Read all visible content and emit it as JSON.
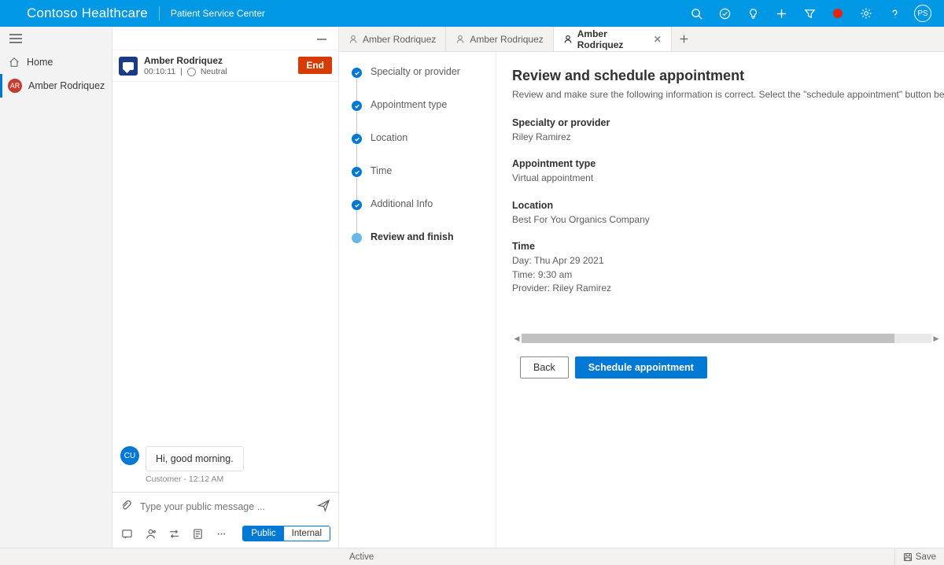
{
  "topbar": {
    "brand": "Contoso Healthcare",
    "subtitle": "Patient Service Center",
    "avatar_initials": "PS"
  },
  "leftnav": {
    "home_label": "Home",
    "session_label": "Amber Rodriquez",
    "session_initials": "AR"
  },
  "conversation": {
    "name": "Amber Rodriquez",
    "timer": "00:10:11",
    "sentiment": "Neutral",
    "end_label": "End",
    "message_sender_initials": "CU",
    "message_text": "Hi, good morning.",
    "message_meta": "Customer - 12:12 AM",
    "compose_placeholder": "Type your public message ...",
    "pill_public": "Public",
    "pill_internal": "Internal"
  },
  "tabs": {
    "t1": "Amber Rodriquez",
    "t2": "Amber Rodriquez",
    "t3": "Amber Rodriquez"
  },
  "stepper": {
    "s1": "Specialty or provider",
    "s2": "Appointment type",
    "s3": "Location",
    "s4": "Time",
    "s5": "Additional Info",
    "s6": "Review and finish"
  },
  "review": {
    "heading": "Review and schedule appointment",
    "description": "Review and make sure the following information is correct. Select the \"schedule appointment\" button below to book the ap",
    "f1_label": "Specialty or provider",
    "f1_value": "Riley Ramirez",
    "f2_label": "Appointment type",
    "f2_value": "Virtual appointment",
    "f3_label": "Location",
    "f3_value": "Best For You Organics Company",
    "f4_label": "Time",
    "f4_day": "Day: Thu Apr 29 2021",
    "f4_time": "Time: 9:30 am",
    "f4_provider": "Provider: Riley Ramirez",
    "back_label": "Back",
    "schedule_label": "Schedule appointment"
  },
  "statusbar": {
    "status": "Active",
    "save": "Save"
  }
}
